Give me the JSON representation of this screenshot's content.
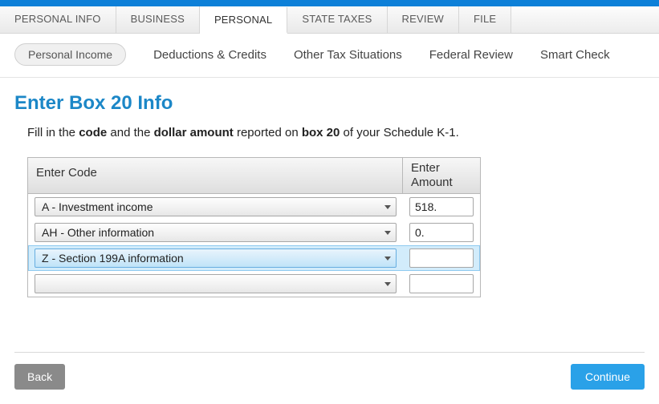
{
  "main_tabs": {
    "t0": "PERSONAL INFO",
    "t1": "BUSINESS",
    "t2": "PERSONAL",
    "t3": "STATE TAXES",
    "t4": "REVIEW",
    "t5": "FILE"
  },
  "sub_tabs": {
    "s0": "Personal Income",
    "s1": "Deductions & Credits",
    "s2": "Other Tax Situations",
    "s3": "Federal Review",
    "s4": "Smart Check"
  },
  "page": {
    "title": "Enter Box 20 Info",
    "instr_pre": "Fill in the ",
    "instr_code": "code",
    "instr_mid1": " and the ",
    "instr_dollar": "dollar amount",
    "instr_mid2": " reported on ",
    "instr_box": "box 20",
    "instr_post": " of your Schedule K-1."
  },
  "table": {
    "head_code": "Enter Code",
    "head_amt": "Enter Amount",
    "rows": [
      {
        "code": "A - Investment income",
        "amount": "518."
      },
      {
        "code": "AH - Other information",
        "amount": "0."
      },
      {
        "code": "Z - Section 199A information",
        "amount": ""
      },
      {
        "code": "",
        "amount": ""
      }
    ]
  },
  "footer": {
    "back": "Back",
    "continue": "Continue"
  }
}
